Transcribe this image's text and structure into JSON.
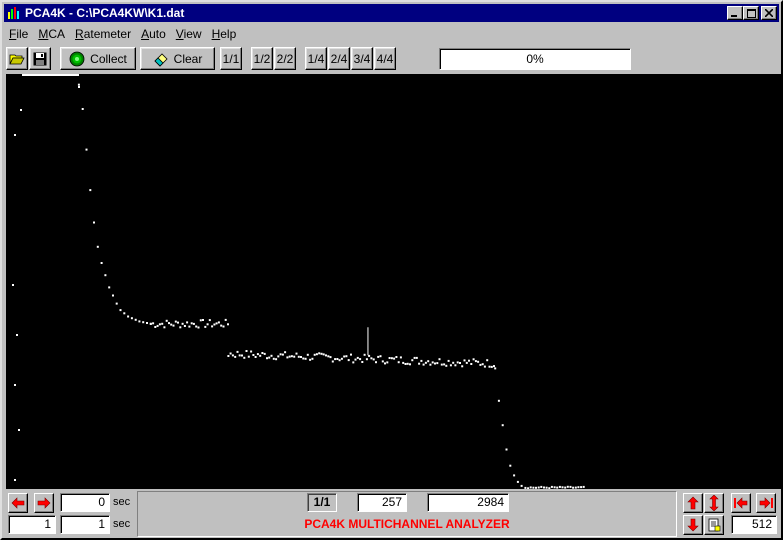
{
  "window": {
    "title": "PCA4K - C:\\PCA4KW\\K1.dat",
    "controls": [
      "_",
      "□",
      "×"
    ]
  },
  "menu": {
    "items": [
      {
        "label": "File",
        "accel": "F",
        "rest": "ile"
      },
      {
        "label": "MCA",
        "accel": "M",
        "rest": "CA"
      },
      {
        "label": "Ratemeter",
        "accel": "R",
        "rest": "atemeter"
      },
      {
        "label": "Auto",
        "accel": "A",
        "rest": "uto"
      },
      {
        "label": "View",
        "accel": "V",
        "rest": "iew"
      },
      {
        "label": "Help",
        "accel": "H",
        "rest": "elp"
      }
    ]
  },
  "toolbar": {
    "open_icon": "folder-open-icon",
    "save_icon": "floppy-disk-icon",
    "collect_label": "Collect",
    "clear_label": "Clear",
    "zoom_buttons": [
      "1/1",
      "1/2",
      "2/2",
      "1/4",
      "2/4",
      "3/4",
      "4/4"
    ],
    "progress_text": "0%",
    "progress_fraction": 0.0
  },
  "bottom": {
    "time_value": "0",
    "time_unit": "sec",
    "preset_value": "1",
    "preset_time": "1",
    "preset_unit": "sec",
    "zoom_label": "1/1",
    "channel": "257",
    "counts": "2984",
    "status_title": "PCA4K MULTICHANNEL ANALYZER",
    "scale_value": "512"
  },
  "colors": {
    "titlebar": "#000080",
    "plot_bg": "#000000",
    "plot_dots": "#ffffff",
    "status_title": "#ff0000",
    "arrow_red": "#ff0000"
  },
  "chart_data": {
    "type": "scatter",
    "title": "",
    "xlabel": "",
    "ylabel": "",
    "xlim": [
      0,
      4096
    ],
    "ylim": [
      0,
      512
    ],
    "marker": {
      "channel": 1913,
      "height": 28
    },
    "segments": [
      {
        "name": "",
        "x_start": 0,
        "x_end": 370,
        "values_desc": "high counts above range",
        "y": [
          512
        ]
      },
      {
        "x": [
          380,
          400,
          420,
          440,
          460,
          480,
          500,
          520,
          540,
          560,
          580,
          600,
          620,
          640,
          660,
          680,
          700,
          720,
          740,
          760
        ],
        "y": [
          500,
          470,
          420,
          370,
          330,
          300,
          280,
          265,
          250,
          240,
          230,
          222,
          218,
          214,
          212,
          210,
          208,
          207,
          206,
          205
        ]
      },
      {
        "x_range": [
          760,
          1170
        ],
        "y_level": 205
      },
      {
        "x_range": [
          1170,
          2580
        ],
        "y_level": 168
      },
      {
        "x": [
          2580,
          2600,
          2620,
          2640,
          2660,
          2680,
          2700,
          2720
        ],
        "y": [
          150,
          110,
          80,
          50,
          30,
          18,
          10,
          5
        ]
      }
    ]
  }
}
